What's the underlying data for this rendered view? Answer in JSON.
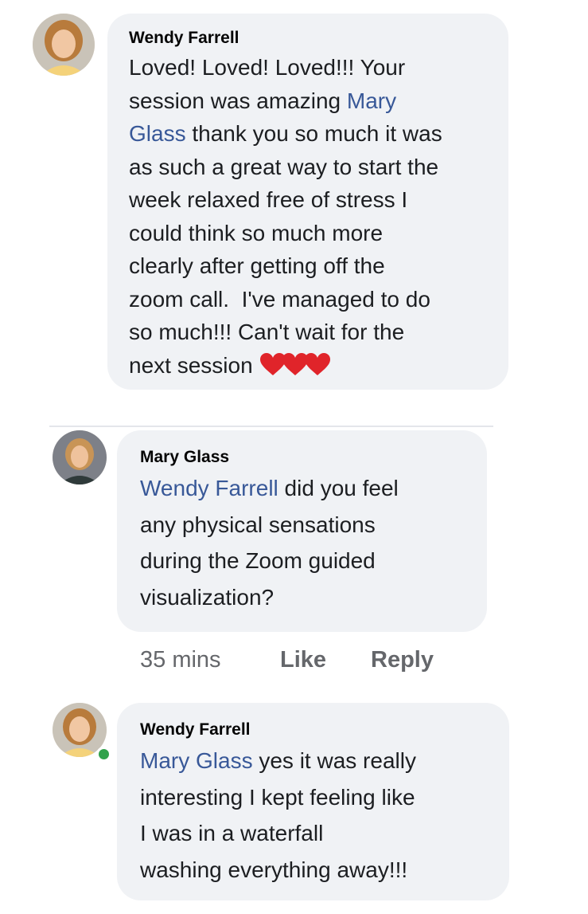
{
  "comments": [
    {
      "author": "Wendy Farrell",
      "avatar": "woman-blonde-avatar",
      "lines": [
        [
          {
            "t": "Loved! Loved! Loved!!! Your"
          }
        ],
        [
          {
            "t": "session was amazing "
          },
          {
            "t": "Mary",
            "mention": true
          }
        ],
        [
          {
            "t": "Glass",
            "mention": true
          },
          {
            "t": " thank you so much it was"
          }
        ],
        [
          {
            "t": "as such a great way to start the"
          }
        ],
        [
          {
            "t": "week relaxed free of stress I"
          }
        ],
        [
          {
            "t": "could think so much more"
          }
        ],
        [
          {
            "t": "clearly after getting off the"
          }
        ],
        [
          {
            "t": "zoom call.  I've managed to do"
          }
        ],
        [
          {
            "t": "so much!!! Can't wait for the"
          }
        ],
        [
          {
            "t": "next session "
          }
        ]
      ],
      "trailing_emoji": "❤❤❤"
    },
    {
      "author": "Mary Glass",
      "avatar": "woman-office-avatar",
      "lines": [
        [
          {
            "t": "Wendy Farrell",
            "mention": true
          },
          {
            "t": " did you feel"
          }
        ],
        [
          {
            "t": "any physical sensations"
          }
        ],
        [
          {
            "t": "during the Zoom guided"
          }
        ],
        [
          {
            "t": "visualization?"
          }
        ]
      ],
      "meta": {
        "time": "35 mins",
        "like": "Like",
        "reply": "Reply"
      }
    },
    {
      "author": "Wendy Farrell",
      "avatar": "woman-blonde-avatar",
      "online": true,
      "lines": [
        [
          {
            "t": "Mary Glass",
            "mention": true
          },
          {
            "t": " yes it was really"
          }
        ],
        [
          {
            "t": "interesting I kept feeling like"
          }
        ],
        [
          {
            "t": "I was in a waterfall"
          }
        ],
        [
          {
            "t": "washing everything away!!!"
          }
        ]
      ]
    }
  ],
  "colors": {
    "bubble": "#f0f2f5",
    "mention": "#385898",
    "meta": "#65676b",
    "online": "#31a24c",
    "heart": "#e0242a"
  }
}
